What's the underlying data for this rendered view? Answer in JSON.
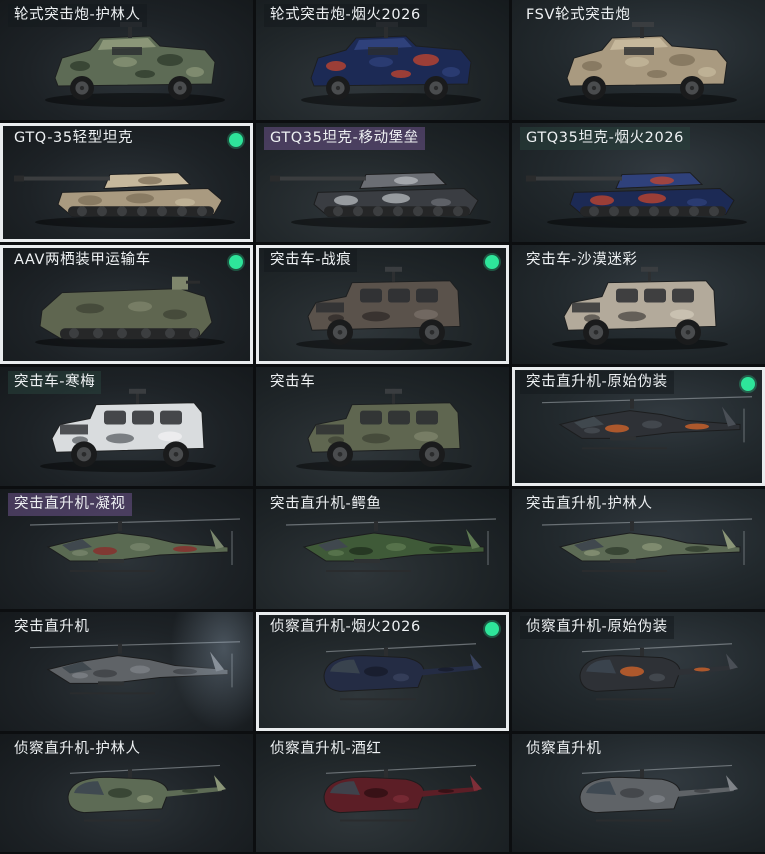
{
  "vehicles": [
    {
      "name": "轮式突击炮-护林人",
      "kind": "apc6",
      "camo": "forest",
      "selected": false,
      "equipped": false,
      "tag": "plain"
    },
    {
      "name": "轮式突击炮-烟火2026",
      "kind": "apc6",
      "camo": "firework",
      "selected": false,
      "equipped": false,
      "tag": "plain"
    },
    {
      "name": "FSV轮式突击炮",
      "kind": "apc6",
      "camo": "sand",
      "selected": false,
      "equipped": false,
      "tag": "none"
    },
    {
      "name": "GTQ-35轻型坦克",
      "kind": "tank",
      "camo": "sand",
      "selected": true,
      "equipped": true,
      "tag": "none"
    },
    {
      "name": "GTQ35坦克-移动堡垒",
      "kind": "tank",
      "camo": "fortress",
      "selected": false,
      "equipped": false,
      "tag": "purple"
    },
    {
      "name": "GTQ35坦克-烟火2026",
      "kind": "tank",
      "camo": "firework",
      "selected": false,
      "equipped": false,
      "tag": "green"
    },
    {
      "name": "AAV两栖装甲运输车",
      "kind": "aav",
      "camo": "olive",
      "selected": true,
      "equipped": true,
      "tag": "none"
    },
    {
      "name": "突击车-战痕",
      "kind": "mrap",
      "camo": "scarred",
      "selected": true,
      "equipped": true,
      "tag": "plain"
    },
    {
      "name": "突击车-沙漠迷彩",
      "kind": "mrap",
      "camo": "desert",
      "selected": false,
      "equipped": false,
      "tag": "none"
    },
    {
      "name": "突击车-寒梅",
      "kind": "mrap",
      "camo": "white",
      "selected": false,
      "equipped": false,
      "tag": "green"
    },
    {
      "name": "突击车",
      "kind": "mrap",
      "camo": "olive",
      "selected": false,
      "equipped": false,
      "tag": "none"
    },
    {
      "name": "突击直升机-原始伪装",
      "kind": "heli",
      "camo": "orange",
      "selected": true,
      "equipped": true,
      "tag": "plain"
    },
    {
      "name": "突击直升机-凝视",
      "kind": "heli",
      "camo": "redgreen",
      "selected": false,
      "equipped": false,
      "tag": "purple"
    },
    {
      "name": "突击直升机-鳄鱼",
      "kind": "heli",
      "camo": "croc",
      "selected": false,
      "equipped": false,
      "tag": "none"
    },
    {
      "name": "突击直升机-护林人",
      "kind": "heli",
      "camo": "forest",
      "selected": false,
      "equipped": false,
      "tag": "none"
    },
    {
      "name": "突击直升机",
      "kind": "heli",
      "camo": "grey",
      "selected": false,
      "equipped": false,
      "tag": "none"
    },
    {
      "name": "侦察直升机-烟火2026",
      "kind": "scout",
      "camo": "navy",
      "selected": true,
      "equipped": true,
      "tag": "none"
    },
    {
      "name": "侦察直升机-原始伪装",
      "kind": "scout",
      "camo": "orange",
      "selected": false,
      "equipped": false,
      "tag": "plain"
    },
    {
      "name": "侦察直升机-护林人",
      "kind": "scout",
      "camo": "forest",
      "selected": false,
      "equipped": false,
      "tag": "none"
    },
    {
      "name": "侦察直升机-酒红",
      "kind": "scout",
      "camo": "wine",
      "selected": false,
      "equipped": false,
      "tag": "none"
    },
    {
      "name": "侦察直升机",
      "kind": "scout",
      "camo": "grey",
      "selected": false,
      "equipped": false,
      "tag": "none"
    }
  ],
  "colors": {
    "selected_border": "#e9ecee",
    "equipped_dot": "#2ee59a",
    "label_text": "#eef1f3"
  }
}
